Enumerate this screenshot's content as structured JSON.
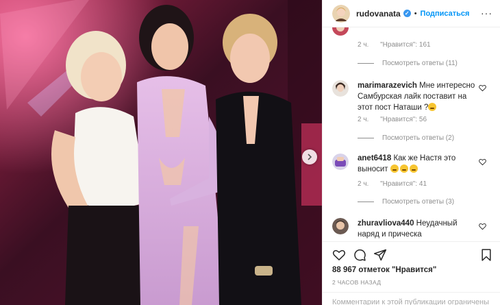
{
  "header": {
    "username": "rudovanata",
    "verified_mark": "✓",
    "separator": "•",
    "follow_label": "Подписаться",
    "more_label": "···"
  },
  "comments": [
    {
      "meta_time": "2 ч.",
      "meta_likes": "\"Нравится\": 161",
      "replies_label": "Посмотреть ответы (11)"
    },
    {
      "username": "marimarazevich",
      "text": "Мне интересно Самбурская лайк поставит на этот пост Наташи ?",
      "meta_time": "2 ч.",
      "meta_likes": "\"Нравится\": 56",
      "replies_label": "Посмотреть ответы (2)"
    },
    {
      "username": "anet6418",
      "text": "Как же Настя это выносит",
      "meta_time": "2 ч.",
      "meta_likes": "\"Нравится\": 41",
      "replies_label": "Посмотреть ответы (3)"
    },
    {
      "username": "zhuravliova440",
      "text": "Неудачный наряд и прическа"
    }
  ],
  "actions": {
    "like_icon": "heart-icon",
    "comment_icon": "comment-icon",
    "share_icon": "share-icon",
    "save_icon": "bookmark-icon"
  },
  "likes_count": "88 967 отметок \"Нравится\"",
  "post_time": "2 ЧАСОВ НАЗАД",
  "add_comment_placeholder": "Комментарии к этой публикации ограничены",
  "colors": {
    "accent": "#0095f6",
    "text": "#262626",
    "muted": "#8e8e8e",
    "border": "#efefef"
  }
}
